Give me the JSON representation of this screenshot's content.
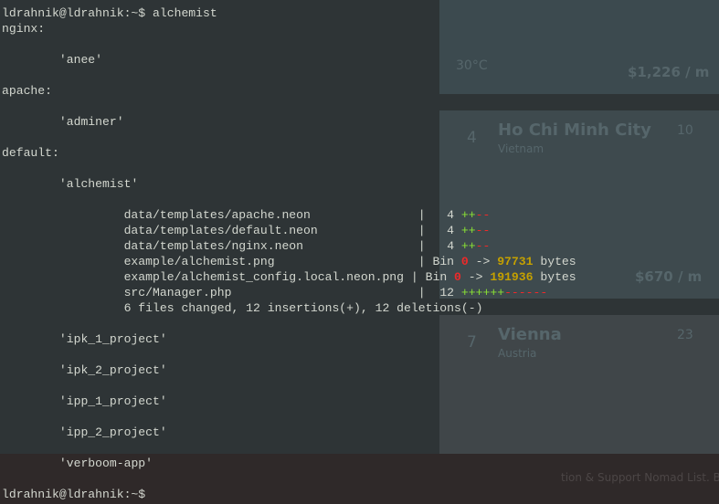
{
  "prompt": "ldrahnik@ldrahnik:~$ ",
  "command": "alchemist",
  "groups": [
    {
      "label": "nginx:",
      "projects": [
        {
          "name": "'anee'"
        }
      ]
    },
    {
      "label": "apache:",
      "projects": [
        {
          "name": "'adminer'"
        }
      ]
    },
    {
      "label": "default:",
      "projects": [
        {
          "name": "'alchemist'",
          "diffstat": {
            "files": [
              {
                "path": "data/templates/apache.neon",
                "count": "4",
                "plus": "++",
                "minus": "--"
              },
              {
                "path": "data/templates/default.neon",
                "count": "4",
                "plus": "++",
                "minus": "--"
              },
              {
                "path": "data/templates/nginx.neon",
                "count": "4",
                "plus": "++",
                "minus": "--"
              },
              {
                "path": "example/alchemist.png",
                "bin": "Bin",
                "from": "0",
                "arrow": "->",
                "to": "97731",
                "unit": "bytes"
              },
              {
                "path": "example/alchemist_config.local.neon.png",
                "bin": "Bin",
                "from": "0",
                "arrow": "->",
                "to": "191936",
                "unit": "bytes"
              },
              {
                "path": "src/Manager.php",
                "count": "12",
                "plus": "++++++",
                "minus": "------"
              }
            ],
            "summary": "6 files changed, 12 insertions(+), 12 deletions(-)"
          }
        },
        {
          "name": "'ipk_1_project'"
        },
        {
          "name": "'ipk_2_project'"
        },
        {
          "name": "'ipp_1_project'"
        },
        {
          "name": "'ipp_2_project'"
        },
        {
          "name": "'verboom-app'"
        }
      ]
    }
  ],
  "background": {
    "card1": {
      "temp": "30°C",
      "cost": "$1,226 / m"
    },
    "card2": {
      "rank": "4",
      "city": "Ho Chi Minh City",
      "country": "Vietnam",
      "score": "10",
      "cost": "$670 / m"
    },
    "card3": {
      "rank": "7",
      "city": "Vienna",
      "country": "Austria",
      "score": "23"
    },
    "footer": "tion & Support Nomad List. B"
  },
  "colors": {
    "terminal_bg": "#2e3436",
    "text": "#d3d7cf",
    "diff_plus": "#8ae234",
    "diff_minus": "#ef2929",
    "byte_count": "#c4a000"
  }
}
